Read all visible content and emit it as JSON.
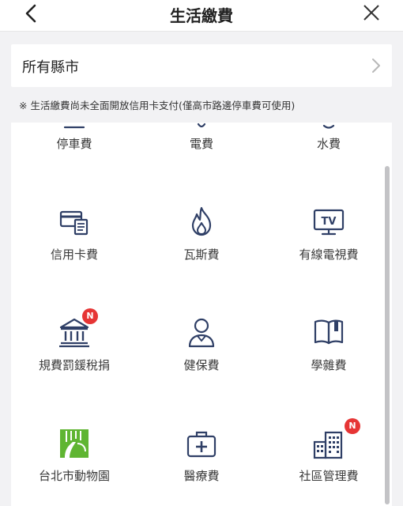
{
  "header": {
    "title": "生活繳費",
    "back_icon": "chevron-left-icon",
    "close_icon": "close-icon"
  },
  "county_selector": {
    "label": "所有縣市",
    "chevron_icon": "chevron-right-icon"
  },
  "notice": "※ 生活繳費尚未全面開放信用卡支付(僅高市路邊停車費可使用)",
  "items": [
    {
      "label": "停車費",
      "icon": "parking-icon"
    },
    {
      "label": "電費",
      "icon": "electricity-icon"
    },
    {
      "label": "水費",
      "icon": "water-icon"
    },
    {
      "label": "信用卡費",
      "icon": "credit-card-icon"
    },
    {
      "label": "瓦斯費",
      "icon": "flame-icon"
    },
    {
      "label": "有線電視費",
      "icon": "tv-icon"
    },
    {
      "label": "規費罰鍰稅捐",
      "icon": "government-building-icon",
      "badge": "N"
    },
    {
      "label": "健保費",
      "icon": "person-icon"
    },
    {
      "label": "學雜費",
      "icon": "book-icon"
    },
    {
      "label": "台北市動物園",
      "icon": "zoo-logo-icon"
    },
    {
      "label": "醫療費",
      "icon": "medical-kit-icon"
    },
    {
      "label": "社區管理費",
      "icon": "apartment-building-icon",
      "badge": "N"
    }
  ],
  "colors": {
    "icon": "#2f3f66",
    "badge": "#e63535",
    "zoo_green": "#5fb532",
    "background": "#f2f2f4"
  }
}
